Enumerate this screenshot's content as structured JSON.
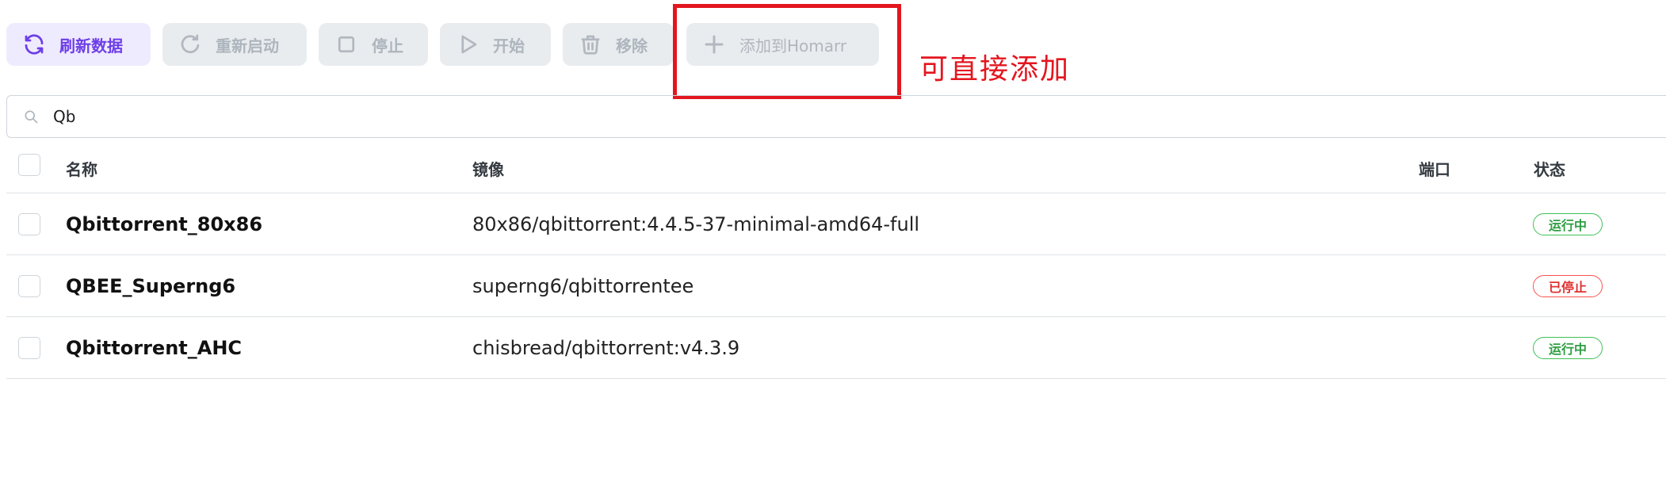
{
  "toolbar": {
    "refresh_label": "刷新数据",
    "restart_label": "重新启动",
    "stop_label": "停止",
    "start_label": "开始",
    "remove_label": "移除",
    "add_homarr_label": "添加到Homarr"
  },
  "annotation": {
    "text": "可直接添加",
    "color": "#e3161f"
  },
  "search": {
    "value": "Qb"
  },
  "table": {
    "headers": {
      "name": "名称",
      "image": "镜像",
      "port": "端口",
      "status": "状态"
    },
    "rows": [
      {
        "name": "Qbittorrent_80x86",
        "image": "80x86/qbittorrent:4.4.5-37-minimal-amd64-full",
        "port": "",
        "status": "运行中",
        "state": "running"
      },
      {
        "name": "QBEE_Superng6",
        "image": "superng6/qbittorrentee",
        "port": "",
        "status": "已停止",
        "state": "stopped"
      },
      {
        "name": "Qbittorrent_AHC",
        "image": "chisbread/qbittorrent:v4.3.9",
        "port": "",
        "status": "运行中",
        "state": "running"
      }
    ]
  },
  "colors": {
    "accent": "#6d3ee8",
    "running": "#2f9e44",
    "stopped": "#e03131"
  },
  "icons": [
    "refresh-icon",
    "restart-icon",
    "stop-icon",
    "play-icon",
    "trash-icon",
    "plus-icon",
    "search-icon"
  ]
}
